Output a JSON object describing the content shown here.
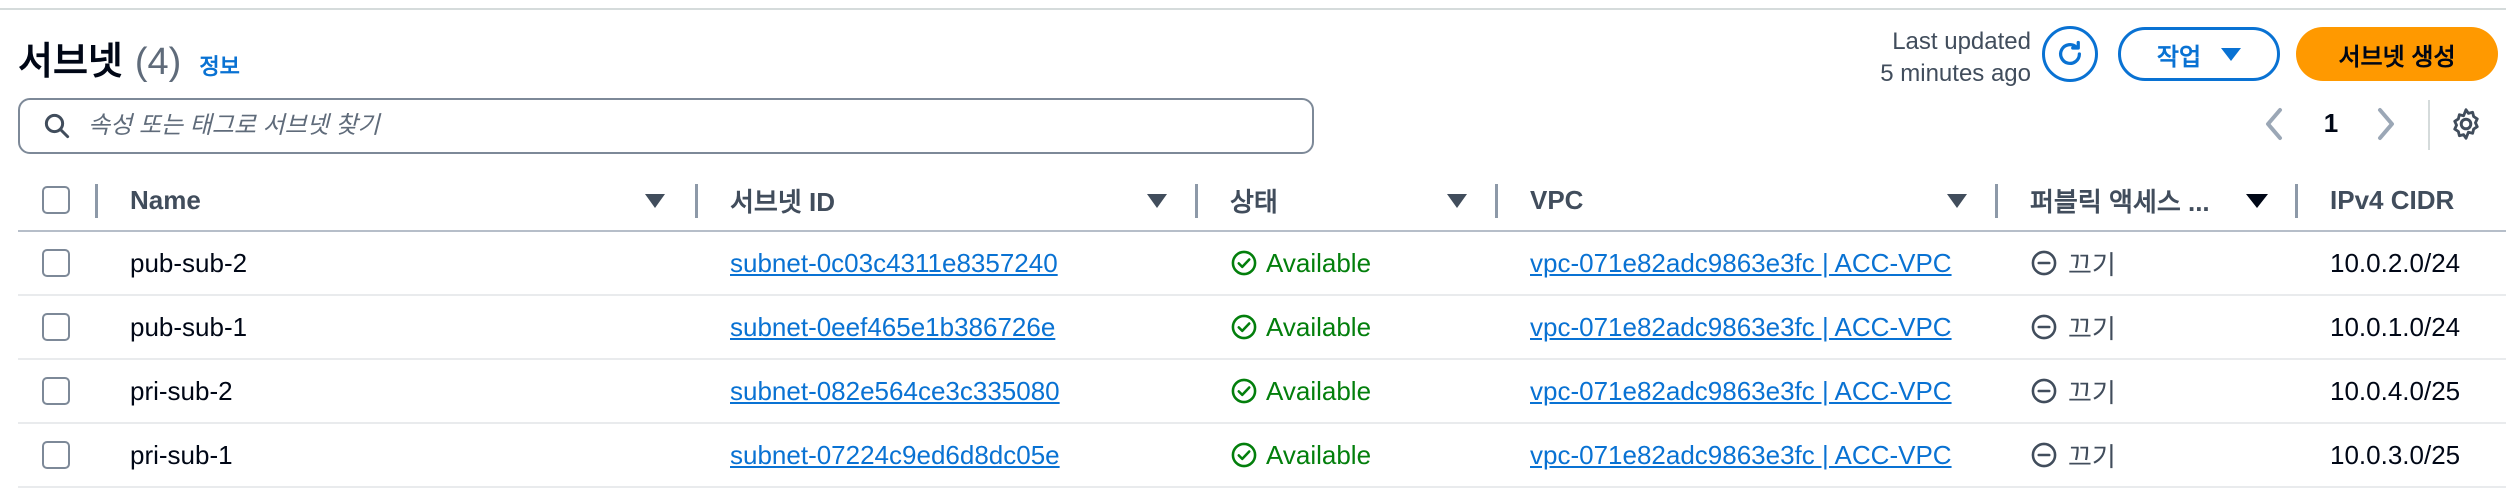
{
  "header": {
    "title": "서브넷",
    "count": "(4)",
    "info_link": "정보",
    "last_updated_line1": "Last updated",
    "last_updated_line2": "5 minutes ago",
    "actions_label": "작업",
    "create_label": "서브넷 생성"
  },
  "search": {
    "placeholder": "속성 또는 태그로 서브넷 찾기",
    "value": ""
  },
  "pagination": {
    "current_page": "1"
  },
  "table": {
    "columns": [
      {
        "label": "Name"
      },
      {
        "label": "서브넷 ID"
      },
      {
        "label": "상태"
      },
      {
        "label": "VPC"
      },
      {
        "label": "퍼블릭 액세스 ..."
      },
      {
        "label": "IPv4 CIDR"
      }
    ],
    "rows": [
      {
        "name": "pub-sub-2",
        "subnet_id": "subnet-0c03c4311e8357240",
        "state": "Available",
        "vpc": "vpc-071e82adc9863e3fc | ACC-VPC",
        "public_access": "끄기",
        "cidr": "10.0.2.0/24"
      },
      {
        "name": "pub-sub-1",
        "subnet_id": "subnet-0eef465e1b386726e",
        "state": "Available",
        "vpc": "vpc-071e82adc9863e3fc | ACC-VPC",
        "public_access": "끄기",
        "cidr": "10.0.1.0/24"
      },
      {
        "name": "pri-sub-2",
        "subnet_id": "subnet-082e564ce3c335080",
        "state": "Available",
        "vpc": "vpc-071e82adc9863e3fc | ACC-VPC",
        "public_access": "끄기",
        "cidr": "10.0.4.0/25"
      },
      {
        "name": "pri-sub-1",
        "subnet_id": "subnet-07224c9ed6d8dc05e",
        "state": "Available",
        "vpc": "vpc-071e82adc9863e3fc | ACC-VPC",
        "public_access": "끄기",
        "cidr": "10.0.3.0/25"
      }
    ]
  },
  "icons": {
    "refresh": "refresh-icon",
    "search": "search-icon",
    "status": "check-circle-icon",
    "off": "minus-circle-icon",
    "settings": "gear-icon"
  },
  "colors": {
    "link": "#0972d3",
    "primary_button": "#ff9900",
    "success": "#037f0c"
  }
}
